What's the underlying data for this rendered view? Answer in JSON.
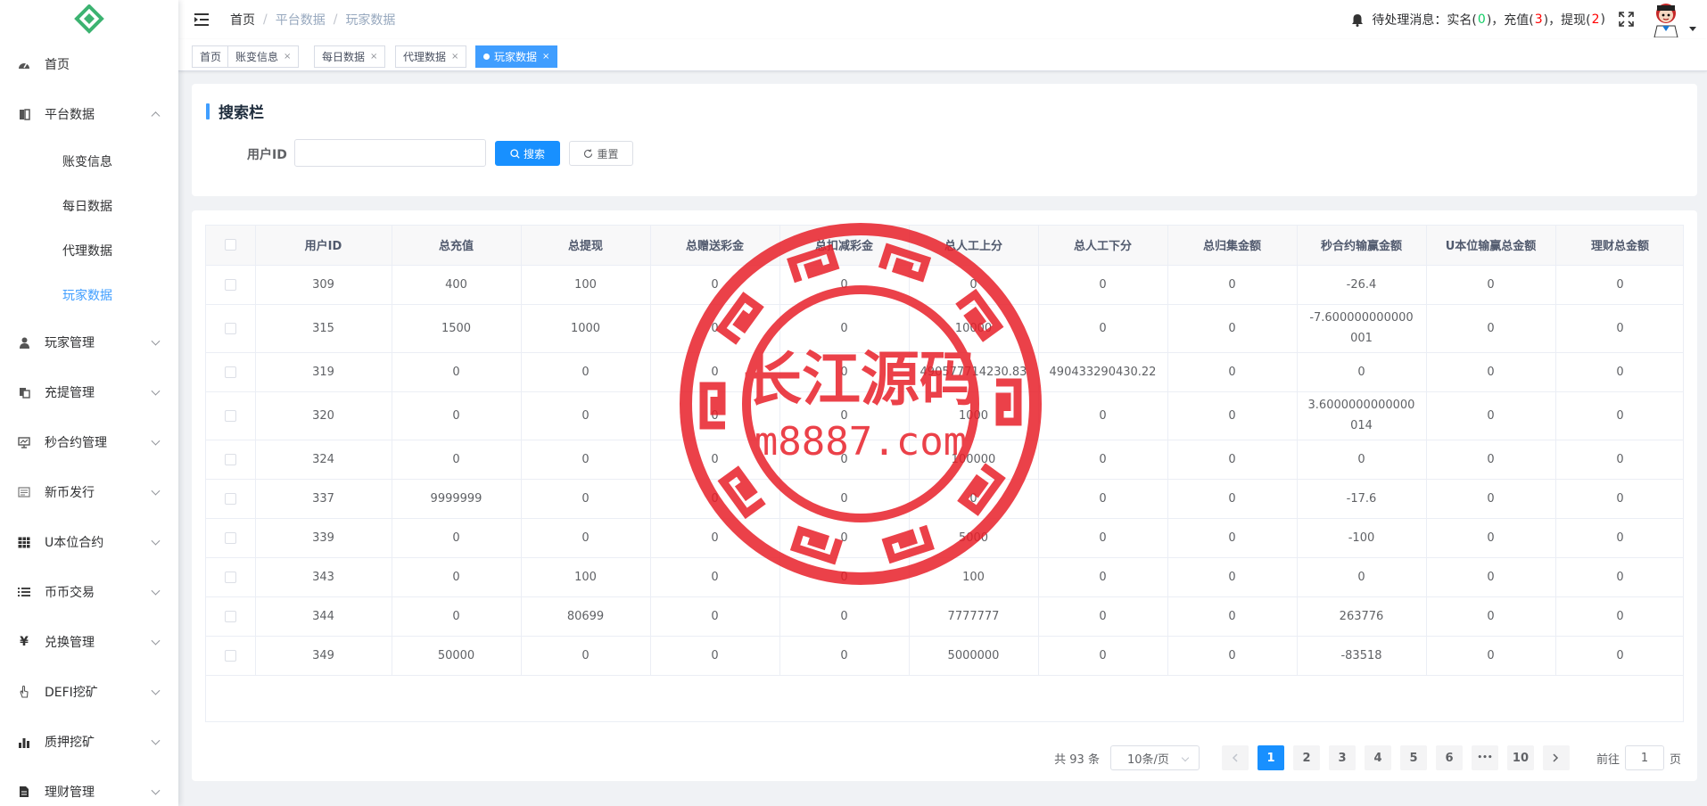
{
  "sidebar": {
    "items": [
      {
        "label": "首页",
        "icon": "dashboard-icon"
      },
      {
        "label": "平台数据",
        "icon": "book-icon",
        "expanded": true
      },
      {
        "label": "玩家管理",
        "icon": "user-icon"
      },
      {
        "label": "充提管理",
        "icon": "copy-icon"
      },
      {
        "label": "秒合约管理",
        "icon": "monitor-icon"
      },
      {
        "label": "新币发行",
        "icon": "doc-icon"
      },
      {
        "label": "U本位合约",
        "icon": "grid-icon"
      },
      {
        "label": "币币交易",
        "icon": "list-icon"
      },
      {
        "label": "兑换管理",
        "icon": "yen-icon"
      },
      {
        "label": "DEFI挖矿",
        "icon": "hand-icon"
      },
      {
        "label": "质押挖矿",
        "icon": "bar-chart-icon"
      },
      {
        "label": "理财管理",
        "icon": "file-icon"
      }
    ],
    "sub_items": [
      "账变信息",
      "每日数据",
      "代理数据",
      "玩家数据"
    ]
  },
  "header": {
    "breadcrumb": [
      "首页",
      "平台数据",
      "玩家数据"
    ],
    "notify_prefix": "待处理消息：实名(",
    "real_name_count": "0",
    "recharge_label": ")，充值(",
    "recharge_count": "3",
    "withdraw_label": ")，提现(",
    "withdraw_count": "2",
    "notify_suffix": ")"
  },
  "tags": {
    "items": [
      "首页",
      "账变信息",
      "每日数据",
      "代理数据",
      "玩家数据"
    ],
    "close": "×"
  },
  "search": {
    "title": "搜索栏",
    "user_id_label": "用户ID",
    "user_id_value": "",
    "search_button": "搜索",
    "reset_button": "重置"
  },
  "table": {
    "columns": [
      "用户ID",
      "总充值",
      "总提现",
      "总赠送彩金",
      "总扣减彩金",
      "总人工上分",
      "总人工下分",
      "总归集金额",
      "秒合约输赢金额",
      "U本位输赢总金额",
      "理财总金额"
    ],
    "rows": [
      [
        "309",
        "400",
        "100",
        "0",
        "0",
        "0",
        "0",
        "0",
        "-26.4",
        "0",
        "0"
      ],
      [
        "315",
        "1500",
        "1000",
        "0",
        "0",
        "10000",
        "0",
        "0",
        "-7.600000000000001",
        "0",
        "0"
      ],
      [
        "319",
        "0",
        "0",
        "0",
        "0",
        "490577714230.83",
        "490433290430.22",
        "0",
        "0",
        "0",
        "0"
      ],
      [
        "320",
        "0",
        "0",
        "0",
        "0",
        "1000",
        "0",
        "0",
        "3.6000000000000014",
        "0",
        "0"
      ],
      [
        "324",
        "0",
        "0",
        "0",
        "0",
        "100000",
        "0",
        "0",
        "0",
        "0",
        "0"
      ],
      [
        "337",
        "9999999",
        "0",
        "0",
        "0",
        "0",
        "0",
        "0",
        "-17.6",
        "0",
        "0"
      ],
      [
        "339",
        "0",
        "0",
        "0",
        "0",
        "5000",
        "0",
        "0",
        "-100",
        "0",
        "0"
      ],
      [
        "343",
        "0",
        "100",
        "0",
        "0",
        "100",
        "0",
        "0",
        "0",
        "0",
        "0"
      ],
      [
        "344",
        "0",
        "80699",
        "0",
        "0",
        "7777777",
        "0",
        "0",
        "263776",
        "0",
        "0"
      ],
      [
        "349",
        "50000",
        "0",
        "0",
        "0",
        "5000000",
        "0",
        "0",
        "-83518",
        "0",
        "0"
      ]
    ]
  },
  "pagination": {
    "total": "共 93 条",
    "page_size": "10条/页",
    "pages": [
      "1",
      "2",
      "3",
      "4",
      "5",
      "6",
      "•••",
      "10"
    ],
    "current": "1",
    "goto_prefix": "前往",
    "goto_value": "1",
    "goto_suffix": "页"
  },
  "watermark": {
    "line1": "长江源码",
    "line2": "m8887.com"
  },
  "colors": {
    "primary": "#1890ff",
    "active_link": "#409eff",
    "green": "#13ce66",
    "red": "#ff0000",
    "watermark": "#e8202a"
  }
}
